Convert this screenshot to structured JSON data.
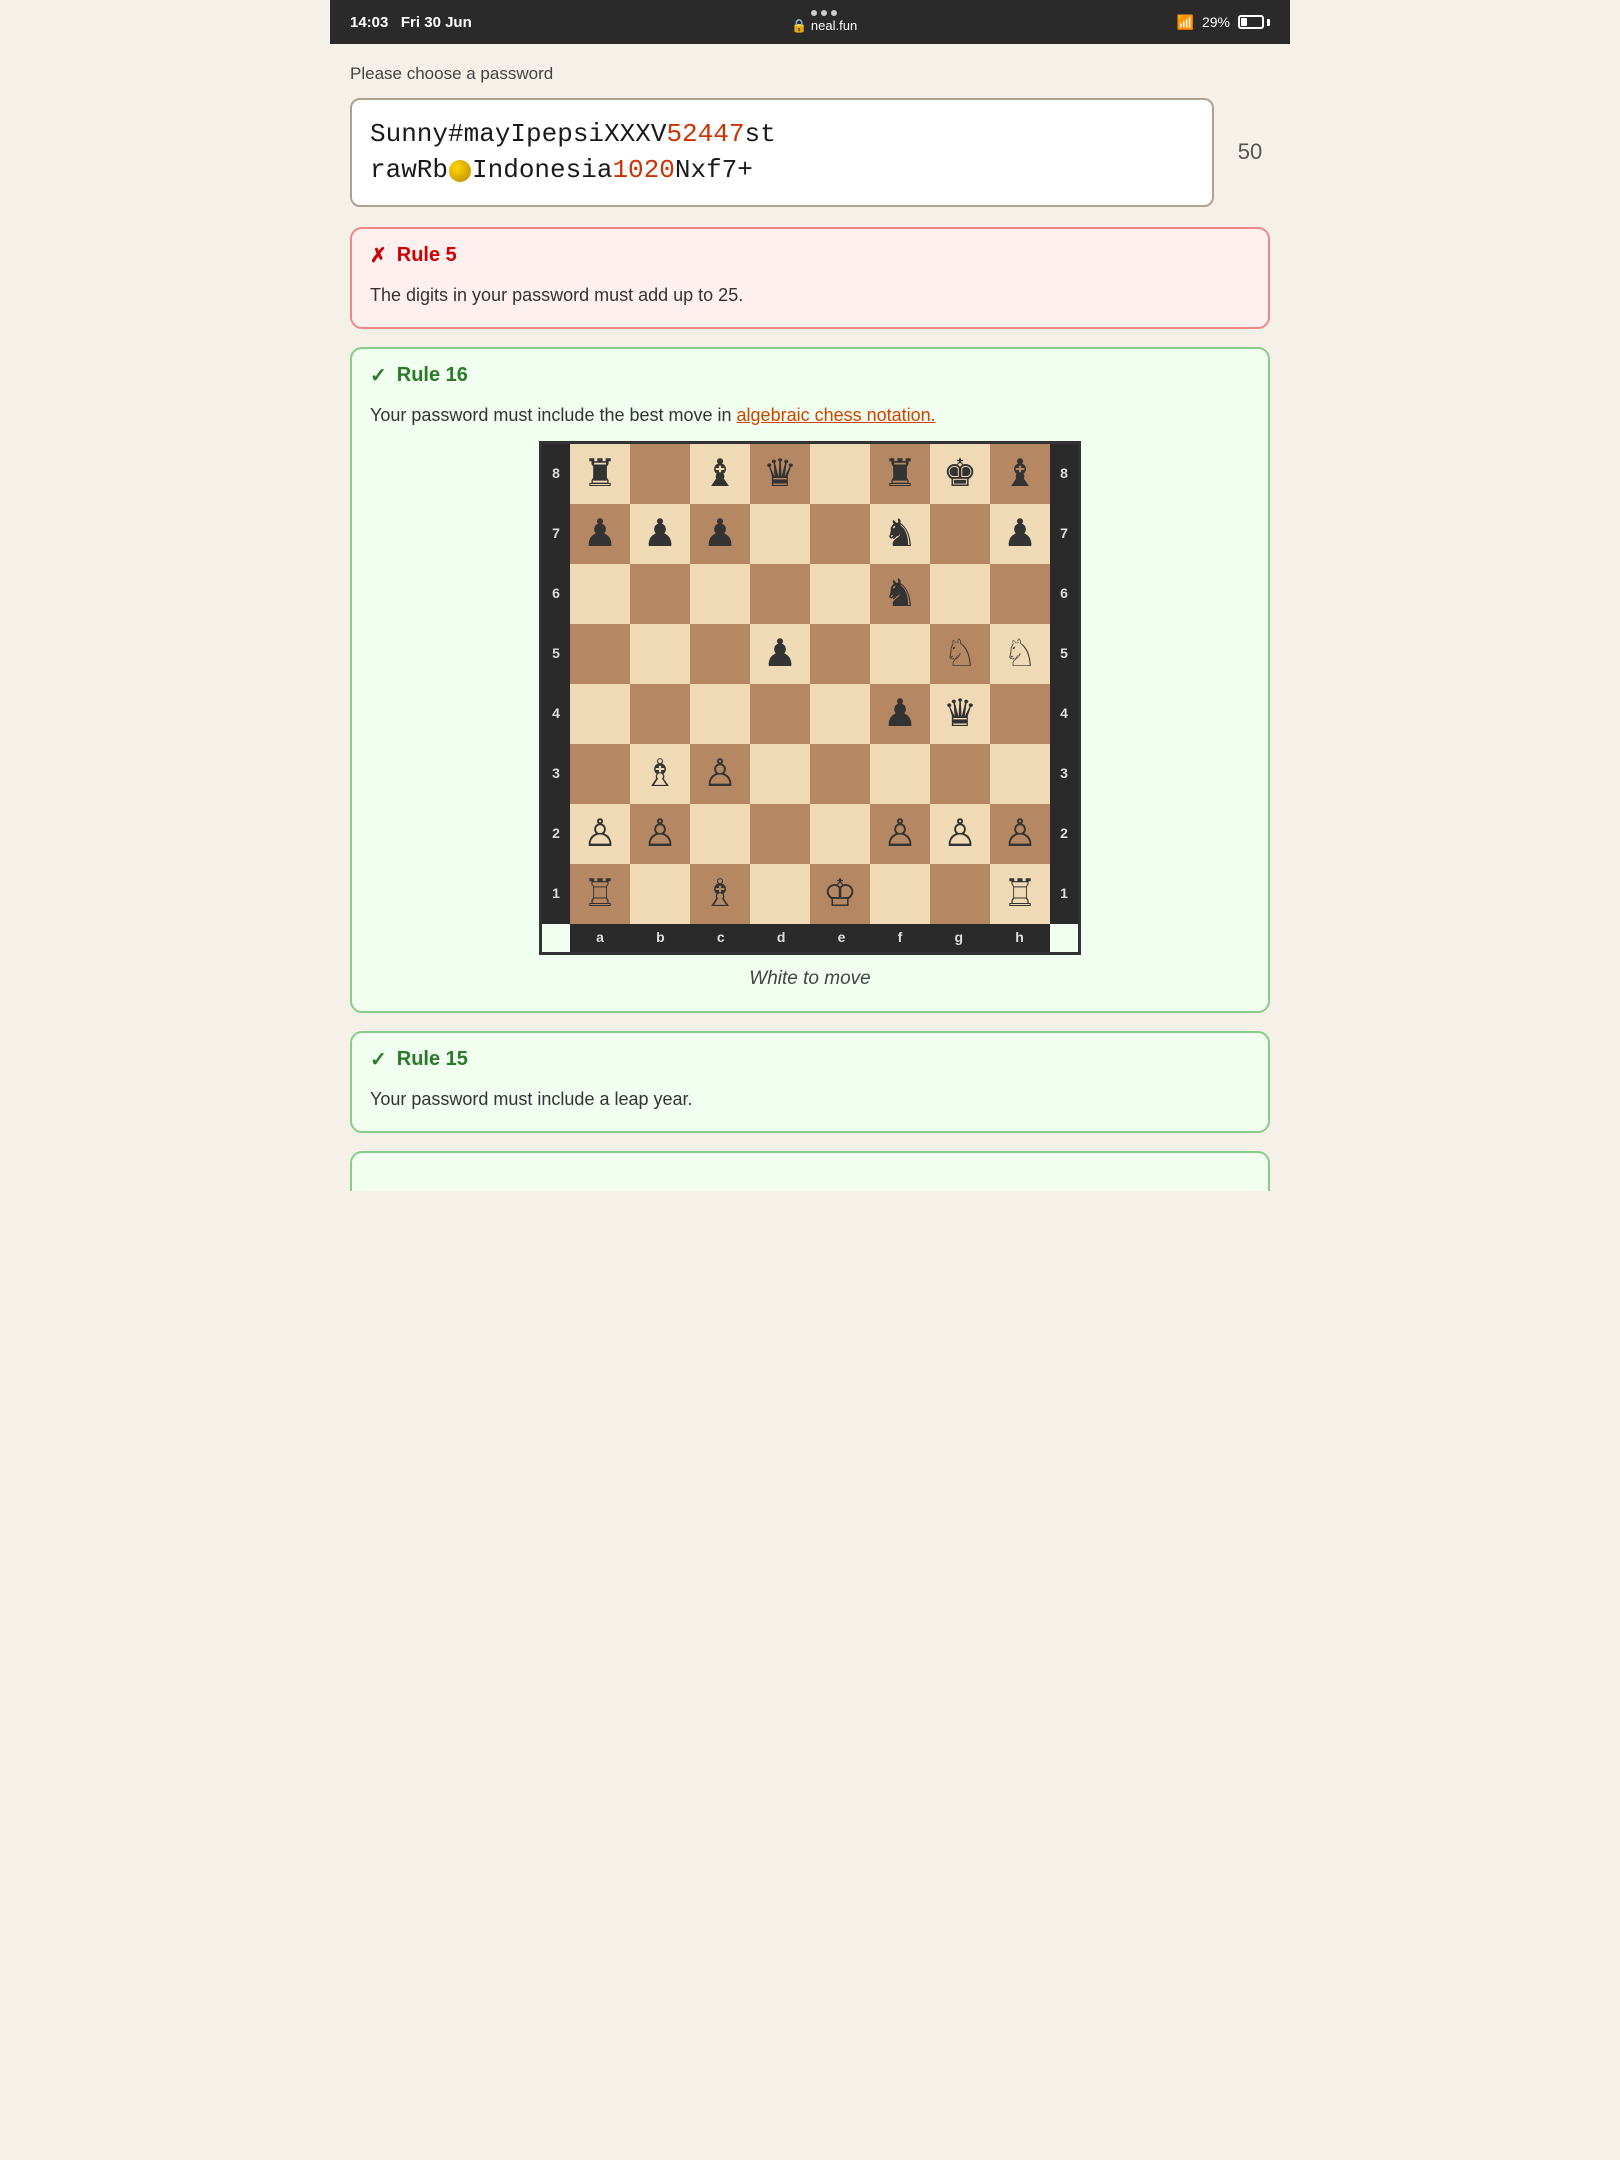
{
  "statusBar": {
    "time": "14:03",
    "date": "Fri 30 Jun",
    "dots": 3,
    "url": "neal.fun",
    "lock": "🔒",
    "battery": "29%"
  },
  "choosePasswordLabel": "Please choose a password",
  "password": {
    "text": "Sunny#mayIpepsiXXXV52447strawRb🌑Indonesia1020Nxf7+",
    "displayParts": [
      {
        "text": "Sunny#mayIpepsiXXXV",
        "type": "normal"
      },
      {
        "text": "52447",
        "type": "highlight"
      },
      {
        "text": "st\nrawRb",
        "type": "normal"
      },
      {
        "text": "COIN",
        "type": "coin"
      },
      {
        "text": "Indonesia",
        "type": "normal"
      },
      {
        "text": "1020",
        "type": "highlight"
      },
      {
        "text": "Nxf7+",
        "type": "normal"
      }
    ],
    "charCount": "50"
  },
  "rules": [
    {
      "id": "rule5",
      "status": "fail",
      "title": "Rule 5",
      "body": "The digits in your password must add up to 25."
    },
    {
      "id": "rule16",
      "status": "pass",
      "title": "Rule 16",
      "bodyPrefix": "Your password must include the best move in ",
      "linkText": "algebraic chess notation.",
      "chessCaption": "White to move",
      "board": {
        "pieces": {
          "a8": "♜",
          "c8": "♝",
          "d8": "♛",
          "f8": "♜",
          "g8": "♚",
          "h8": "♝",
          "a7": "♟",
          "b7": "♟",
          "c7": "♟",
          "f7": "♞",
          "h7": "♟",
          "f6": "♞",
          "d5": "♟",
          "g5": "♘",
          "h5": "♘",
          "f4": "♟",
          "g4": "♛",
          "b3": "♗",
          "c3": "♙",
          "a2": "♙",
          "b2": "♙",
          "f2": "♙",
          "g2": "♙",
          "h2": "♙",
          "a1": "♖",
          "c1": "♗",
          "e1": "♔",
          "h1": "♖"
        }
      }
    },
    {
      "id": "rule15",
      "status": "pass",
      "title": "Rule 15",
      "body": "Your password must include a leap year."
    }
  ],
  "labels": {
    "whiteToMove": "White to move",
    "checkIcon": "✓",
    "crossIcon": "✗",
    "files": [
      "a",
      "b",
      "c",
      "d",
      "e",
      "f",
      "g",
      "h"
    ],
    "ranks": [
      "8",
      "7",
      "6",
      "5",
      "4",
      "3",
      "2",
      "1"
    ]
  }
}
